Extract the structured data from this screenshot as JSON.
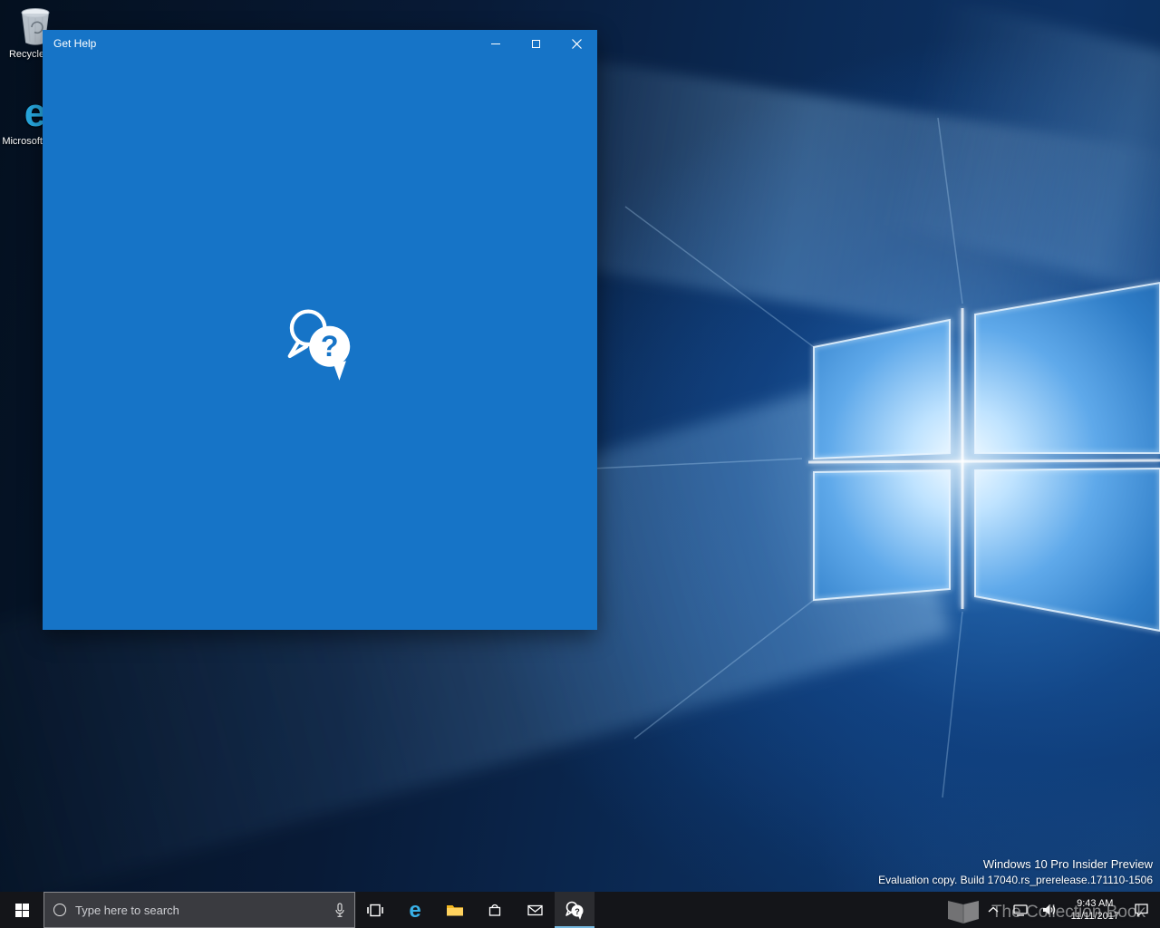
{
  "desktop": {
    "icons": [
      {
        "label": "Recycle Bin"
      },
      {
        "label": "Microsoft Edge"
      }
    ],
    "watermark": {
      "line1": "Windows 10 Pro Insider Preview",
      "line2": "Evaluation copy. Build 17040.rs_prerelease.171110-1506"
    },
    "overlay_watermark": "The Collection Book"
  },
  "window": {
    "title": "Get Help"
  },
  "taskbar": {
    "search": {
      "placeholder": "Type here to search"
    },
    "clock": {
      "time": "9:43 AM",
      "date": "11/11/2017"
    }
  },
  "icons": {
    "edge_glyph": "e",
    "question_glyph": "?",
    "start": "windows-logo",
    "cortana": "search-circle",
    "mic": "microphone",
    "task_view": "task-view",
    "file_explorer": "folder",
    "store": "shopping-bag",
    "mail": "envelope",
    "get_help": "chat-question-bubbles",
    "chevron": "chevron-up",
    "network": "network",
    "volume": "speaker",
    "action_center": "notification-bubble",
    "recycle_bin": "recycle-bin"
  },
  "colors": {
    "window_blue": "#1674c7",
    "taskbar": "#141519",
    "accent": "#0078d7"
  }
}
